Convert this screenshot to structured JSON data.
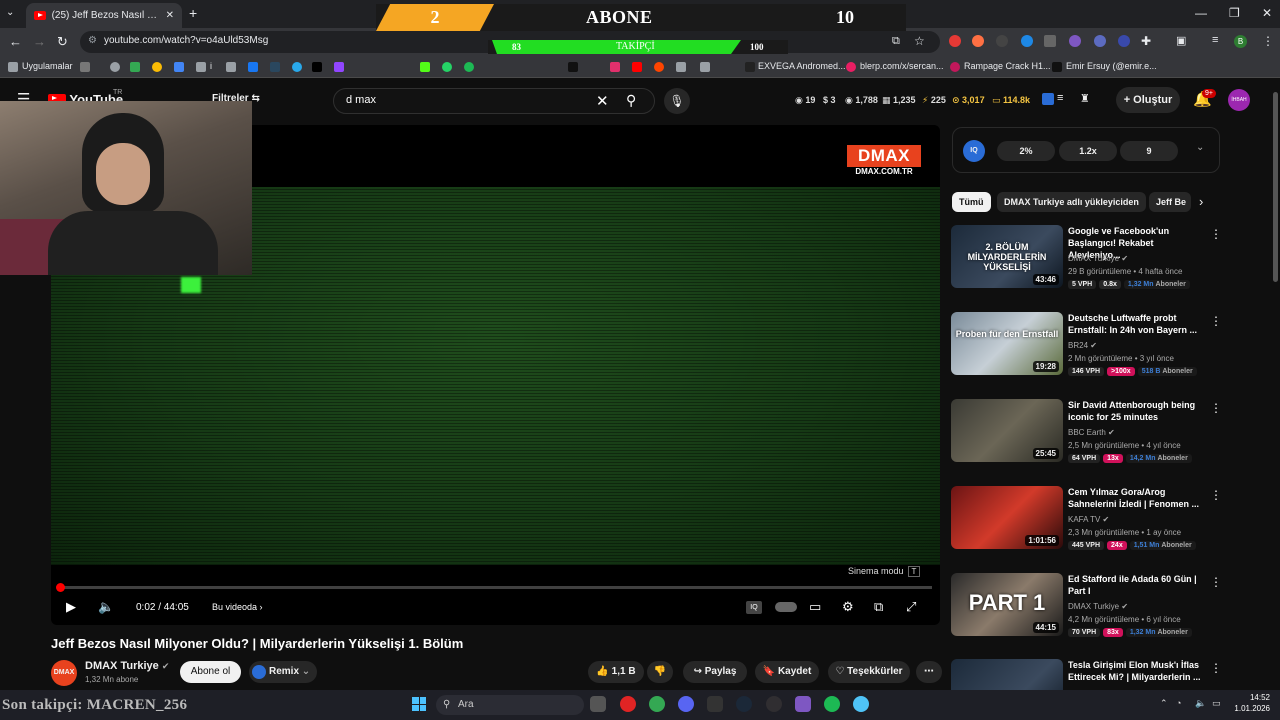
{
  "browser": {
    "tab_title": "(25) Jeff Bezos Nasıl Milyoner O",
    "url": "youtube.com/watch?v=o4aUld53Msg",
    "bookmarks": [
      {
        "label": "Uygulamalar"
      },
      {
        "label": "i"
      },
      {
        "label": "EXVEGA Andromed..."
      },
      {
        "label": "blerp.com/x/sercan..."
      },
      {
        "label": "Rampage Crack H1..."
      },
      {
        "label": "Emir Ersuy (@emir.e..."
      }
    ],
    "profile_letter": "B"
  },
  "stream_overlay": {
    "abone_current": "2",
    "abone_label": "ABONE",
    "abone_goal": "10",
    "takipci_current": "83",
    "takipci_label": "TAKİPÇİ",
    "takipci_goal": "100",
    "takipci_progress": 0.83,
    "last_follower": "Son takipçi: MACREN_256"
  },
  "youtube": {
    "logo_region": "TR",
    "filters_label": "Filtreler",
    "search_query": "d max",
    "header_stats": [
      "19",
      "3",
      "1,788",
      "1,235",
      "225",
      "3,017",
      "114.8k"
    ],
    "create_label": "Oluştur",
    "notif_badge": "9+",
    "avatar_text": "İHBAH"
  },
  "player": {
    "watermark": "DMAX",
    "watermark_sub": "DMAX.COM.TR",
    "cinema_label": "Sinema modu",
    "cinema_key": "T",
    "time_current": "0:02",
    "time_total": "44:05",
    "time_display": "0:02 / 44:05",
    "in_video_label": "Bu videoda",
    "progress": 0.0008
  },
  "video": {
    "title": "Jeff Bezos Nasıl Milyoner Oldu? | Milyarderlerin Yükselişi 1. Bölüm",
    "channel": "DMAX Turkiye",
    "channel_avatar": "DMAX",
    "subscribers": "1,32 Mn abone",
    "subscribe_label": "Abone ol",
    "remix_label": "Remix",
    "likes": "1,1 B",
    "share_label": "Paylaş",
    "save_label": "Kaydet",
    "thanks_label": "Teşekkürler"
  },
  "iq_panel": {
    "logo": "IQ",
    "values": [
      "2%",
      "1.2x",
      "9"
    ]
  },
  "chips": [
    "Tümü",
    "DMAX Turkiye adlı yükleyiciden",
    "Jeff Be"
  ],
  "recommendations": [
    {
      "title": "Google ve Facebook'un Başlangıcı! Rekabet Alevleniyo...",
      "channel": "DMAX Turkiye",
      "meta": "29 B görüntüleme • 4 hafta önce",
      "duration": "43:46",
      "vph": "5 VPH",
      "ratio": "0.8x",
      "subs": "1,32 Mn",
      "subs_label": "Aboneler",
      "ratio_color": "#272727",
      "thumb_text": "2. BÖLÜM MİLYARDERLERİN YÜKSELİŞİ"
    },
    {
      "title": "Deutsche Luftwaffe probt Ernstfall: In 24h von Bayern ...",
      "channel": "BR24",
      "meta": "2 Mn görüntüleme • 3 yıl önce",
      "duration": "19:28",
      "vph": "146 VPH",
      "ratio": ">100x",
      "subs": "518 B",
      "subs_label": "Aboneler",
      "ratio_color": "#d0115a",
      "thumb_text": "Proben für den Ernstfall"
    },
    {
      "title": "Sir David Attenborough being iconic for 25 minutes",
      "channel": "BBC Earth",
      "meta": "2,5 Mn görüntüleme • 4 yıl önce",
      "duration": "25:45",
      "vph": "64 VPH",
      "ratio": "13x",
      "subs": "14,2 Mn",
      "subs_label": "Aboneler",
      "ratio_color": "#d0115a",
      "thumb_text": ""
    },
    {
      "title": "Cem Yılmaz Gora/Arog Sahnelerini İzledi | Fenomen ...",
      "channel": "KAFA TV",
      "meta": "2,3 Mn görüntüleme • 1 ay önce",
      "duration": "1:01:56",
      "vph": "445 VPH",
      "ratio": "24x",
      "subs": "1,51 Mn",
      "subs_label": "Aboneler",
      "ratio_color": "#d0115a",
      "thumb_text": ""
    },
    {
      "title": "Ed Stafford ile Adada 60 Gün | Part I",
      "channel": "DMAX Turkiye",
      "meta": "4,2 Mn görüntüleme • 6 yıl önce",
      "duration": "44:15",
      "vph": "70 VPH",
      "ratio": "83x",
      "subs": "1,32 Mn",
      "subs_label": "Aboneler",
      "ratio_color": "#d0115a",
      "thumb_text": "PART 1"
    },
    {
      "title": "Tesla Girişimi Elon Musk'ı İflas Ettirecek Mi? | Milyarderlerin ...",
      "channel": "",
      "meta": "",
      "duration": "",
      "vph": "",
      "ratio": "",
      "subs": "",
      "subs_label": "",
      "ratio_color": "#272727",
      "thumb_text": ""
    }
  ],
  "taskbar": {
    "search_placeholder": "Ara",
    "time": "14:52",
    "date": "1.01.2026"
  }
}
